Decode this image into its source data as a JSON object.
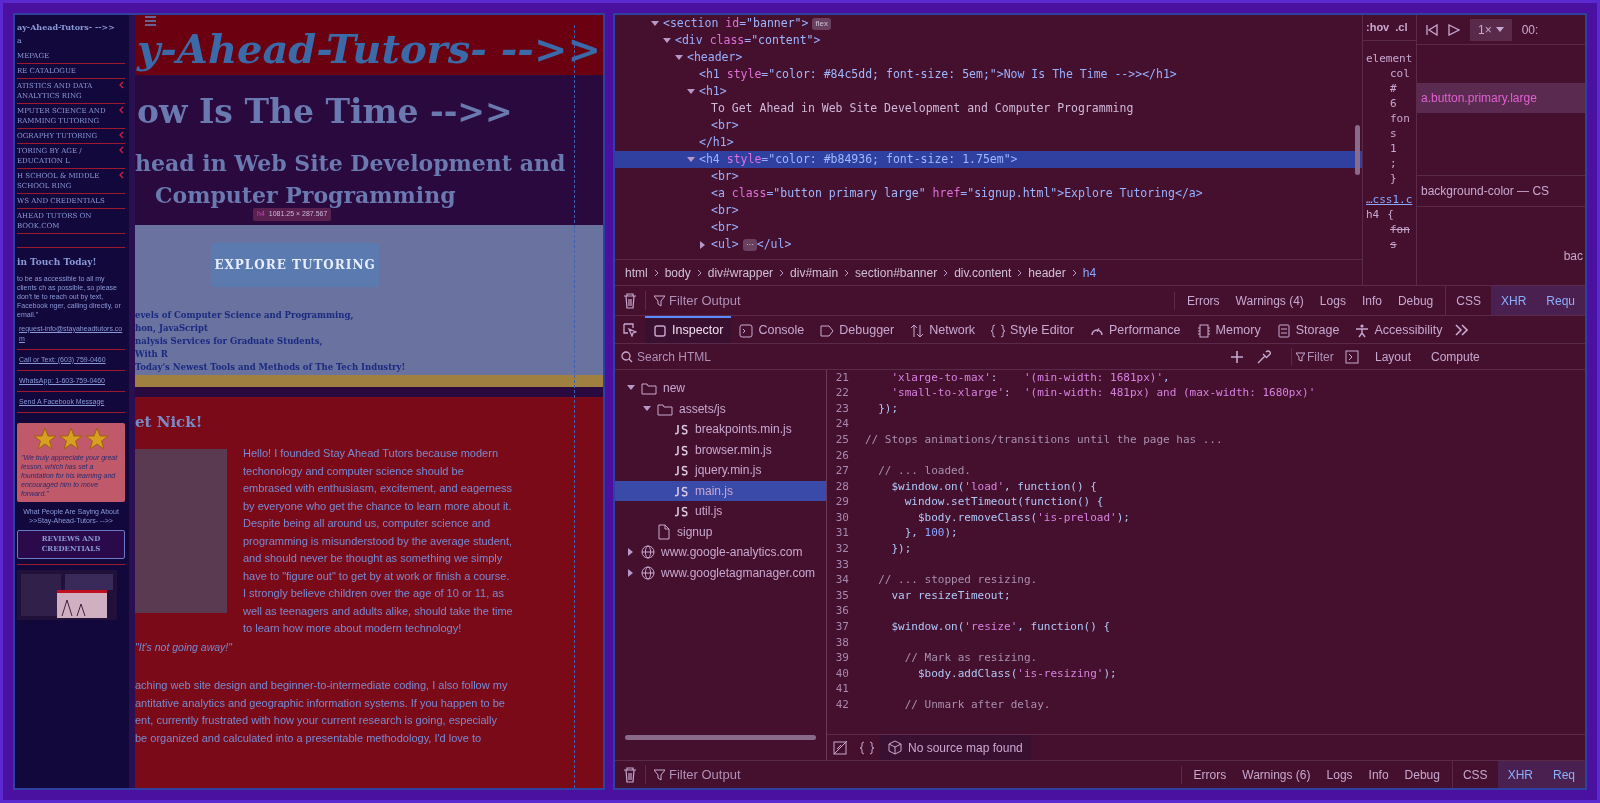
{
  "page": {
    "sidebar": {
      "title": "ay-Ahead-Tutors- -->>",
      "subtitle": "a",
      "menu": [
        {
          "label": "MEPAGE",
          "expandable": false
        },
        {
          "label": "RE CATALOGUE",
          "expandable": false
        },
        {
          "label": "ATISTICS AND DATA ANALYTICS RING",
          "expandable": true
        },
        {
          "label": "MPUTER SCIENCE AND RAMMING TUTORING",
          "expandable": true
        },
        {
          "label": "OGRAPHY TUTORING",
          "expandable": true
        },
        {
          "label": "TORING BY AGE / EDUCATION L",
          "expandable": true
        },
        {
          "label": "H SCHOOL & MIDDLE SCHOOL RING",
          "expandable": true
        },
        {
          "label": "WS AND CREDENTIALS",
          "expandable": false
        },
        {
          "label": "AHEAD TUTORS ON BOOK.COM",
          "expandable": false
        }
      ],
      "contact_heading": "in Touch Today!",
      "contact_text": "to be as accessible to all my clients ch as possible, so please don't te to reach out by text, Facebook nger, calling directly, or email.\"",
      "contacts": [
        "request-info@stayaheadtutors.com",
        "Call or Text: (603) 759-0460",
        "WhatsApp: 1-603-759-0460",
        "Send A Facebook Message"
      ],
      "testimonial": {
        "stars": 3,
        "quote": "\"We truly appreciate your great lesson, which has set a foundation for his learning and encouraged him to move forward.\""
      },
      "caption": "What People Are Saying About >>Stay-Ahead-Tutors- -->>",
      "button": "REVIEWS AND CREDENTIALS"
    },
    "main": {
      "site_title": "y-Ahead-Tutors- -->>",
      "headline": "ow Is The Time -->>",
      "subheadline": [
        "head in Web Site Development and",
        "Computer Programming"
      ],
      "tooltip": {
        "tag": "h4",
        "size": "1081.25 × 287.567"
      },
      "cta_button": "EXPLORE TUTORING",
      "services": [
        "evels of Computer Science and Programming,",
        "hon, JavaScript",
        "nalysis Services for Graduate Students,",
        "With R",
        "Today's Newest Tools and Methods of The Tech Industry!"
      ],
      "about_heading": "et Nick!",
      "about_text": "Hello! I founded Stay Ahead Tutors because modern techonology and computer science should be embrased with enthusiasm, excitement, and eagerness by everyone who get the chance to learn more about it. Despite being all around us, computer science and programming is misunderstood by the average student, and should never be thought as something we simply have to \"figure out\" to get by at work or finish a course. I strongly believe children over the age of 10 or 11, as well as teenagers and adults alike, should take the time to learn how more about modern technology!",
      "about_quote": "\"It's not going away!\"",
      "more_text": [
        "aching web site design and beginner-to-intermediate coding, I also follow my",
        "antitative analytics and geographic information systems. If you happen to be",
        "ent, currently frustrated with how your current research is going, especially",
        "be organized and calculated into a presentable methodology, I'd love to"
      ]
    }
  },
  "devtools": {
    "html_tree": [
      {
        "kind": "element",
        "markup": "<section id=\"banner\">",
        "badge": "flex",
        "expanded": true,
        "selected": false,
        "children": [
          {
            "kind": "element",
            "markup": "<div class=\"content\">",
            "expanded": true,
            "selected": false,
            "children": [
              {
                "kind": "element",
                "markup": "<header>",
                "expanded": true,
                "selected": false,
                "children": [
                  {
                    "kind": "element",
                    "markup": "<h1 style=\"color: #84c5dd; font-size: 5em;\">Now Is The Time -->></h1>",
                    "selected": false
                  },
                  {
                    "kind": "element",
                    "markup": "<h1>",
                    "expanded": true,
                    "selected": false,
                    "children": [
                      {
                        "kind": "text",
                        "markup": "To Get Ahead in Web Site Development and Computer Programming",
                        "selected": false
                      },
                      {
                        "kind": "element",
                        "markup": "<br>",
                        "selected": false
                      }
                    ]
                  },
                  {
                    "kind": "element",
                    "markup": "</h1>",
                    "selected": false
                  },
                  {
                    "kind": "element",
                    "markup": "<h4 style=\"color: #b84936; font-size: 1.75em\">",
                    "expanded": true,
                    "selected": true,
                    "children": [
                      {
                        "kind": "element",
                        "markup": "<br>",
                        "selected": false
                      },
                      {
                        "kind": "element",
                        "markup": "<a class=\"button primary large\" href=\"signup.html\">Explore Tutoring</a>",
                        "selected": false
                      },
                      {
                        "kind": "element",
                        "markup": "<br>",
                        "selected": false
                      },
                      {
                        "kind": "element",
                        "markup": "<br>",
                        "selected": false
                      },
                      {
                        "kind": "element",
                        "markup": "<ul>",
                        "badge": "⋯",
                        "after": "</ul>",
                        "expanded": false,
                        "selected": false
                      }
                    ]
                  }
                ]
              }
            ]
          }
        ]
      }
    ],
    "breadcrumbs": [
      {
        "label": "html",
        "selected": false
      },
      {
        "label": "body",
        "selected": false
      },
      {
        "label": "div#wrapper",
        "selected": false
      },
      {
        "label": "div#main",
        "selected": false
      },
      {
        "label": "section#banner",
        "selected": false
      },
      {
        "label": "div.content",
        "selected": false
      },
      {
        "label": "header",
        "selected": false
      },
      {
        "label": "h4",
        "selected": true
      }
    ],
    "rules_pane": {
      "tabs": [
        ":hov",
        ".cl"
      ],
      "lines": [
        "element",
        "col",
        "#",
        "6",
        "fon",
        "s",
        "1",
        ";",
        "}"
      ],
      "source": "…css1.c",
      "selector": "h4",
      "brace": "{",
      "lines2": [
        "fon",
        "s"
      ]
    },
    "animations": {
      "speed": "1×",
      "time": "00:",
      "target": "a.button.primary.large",
      "property": "background-color — CS",
      "value": "bac"
    },
    "console_bar": {
      "placeholder": "Filter Output",
      "levels": [
        "Errors",
        "Warnings (4)",
        "Logs",
        "Info",
        "Debug"
      ],
      "types": [
        {
          "label": "CSS",
          "selected": false
        },
        {
          "label": "XHR",
          "selected": true
        },
        {
          "label": "Requ",
          "selected": true
        }
      ]
    },
    "tabs": [
      {
        "label": "Inspector",
        "selected": true
      },
      {
        "label": "Console",
        "selected": false
      },
      {
        "label": "Debugger",
        "selected": false
      },
      {
        "label": "Network",
        "selected": false
      },
      {
        "label": "Style Editor",
        "selected": false
      },
      {
        "label": "Performance",
        "selected": false
      },
      {
        "label": "Memory",
        "selected": false
      },
      {
        "label": "Storage",
        "selected": false
      },
      {
        "label": "Accessibility",
        "selected": false
      }
    ],
    "search": {
      "placeholder": "Search HTML",
      "filter_placeholder": "Filter",
      "side_tabs": [
        "Layout",
        "Compute"
      ]
    },
    "sources": [
      {
        "kind": "folder",
        "label": "new",
        "expanded": true,
        "selected": false,
        "children": [
          {
            "kind": "folder",
            "label": "assets/js",
            "expanded": true,
            "selected": false,
            "children": [
              {
                "kind": "js",
                "label": "breakpoints.min.js",
                "selected": false
              },
              {
                "kind": "js",
                "label": "browser.min.js",
                "selected": false
              },
              {
                "kind": "js",
                "label": "jquery.min.js",
                "selected": false
              },
              {
                "kind": "js",
                "label": "main.js",
                "selected": true
              },
              {
                "kind": "js",
                "label": "util.js",
                "selected": false
              }
            ]
          },
          {
            "kind": "file",
            "label": "signup",
            "selected": false
          }
        ]
      },
      {
        "kind": "host",
        "label": "www.google-analytics.com",
        "expanded": false,
        "selected": false
      },
      {
        "kind": "host",
        "label": "www.googletagmanager.com",
        "expanded": false,
        "selected": false
      }
    ],
    "code": [
      {
        "num": "21",
        "text": "    'xlarge-to-max':    '(min-width: 1681px)',"
      },
      {
        "num": "22",
        "text": "    'small-to-xlarge':  '(min-width: 481px) and (max-width: 1680px)'"
      },
      {
        "num": "23",
        "text": "  });"
      },
      {
        "num": "24"
      },
      {
        "num": "25",
        "text": "// Stops animations/transitions until the page has ..."
      },
      {
        "num": "26"
      },
      {
        "num": "27",
        "text": "  // ... loaded."
      },
      {
        "num": "28",
        "text": "    $window.on('load', function() {"
      },
      {
        "num": "29",
        "text": "      window.setTimeout(function() {"
      },
      {
        "num": "30",
        "text": "        $body.removeClass('is-preload');"
      },
      {
        "num": "31",
        "text": "      }, 100);"
      },
      {
        "num": "32",
        "text": "    });"
      },
      {
        "num": "33"
      },
      {
        "num": "34",
        "text": "  // ... stopped resizing."
      },
      {
        "num": "35",
        "text": "    var resizeTimeout;"
      },
      {
        "num": "36"
      },
      {
        "num": "37",
        "text": "    $window.on('resize', function() {"
      },
      {
        "num": "38"
      },
      {
        "num": "39",
        "text": "      // Mark as resizing."
      },
      {
        "num": "40",
        "text": "        $body.addClass('is-resizing');"
      },
      {
        "num": "41"
      },
      {
        "num": "42",
        "text": "      // Unmark after delay."
      }
    ],
    "source_status": "No source map found",
    "bottom_bar": {
      "placeholder": "Filter Output",
      "levels": [
        "Errors",
        "Warnings (6)",
        "Logs",
        "Info",
        "Debug"
      ],
      "types": [
        {
          "label": "CSS",
          "selected": false
        },
        {
          "label": "XHR",
          "selected": true
        },
        {
          "label": "Req",
          "selected": true
        }
      ]
    }
  }
}
